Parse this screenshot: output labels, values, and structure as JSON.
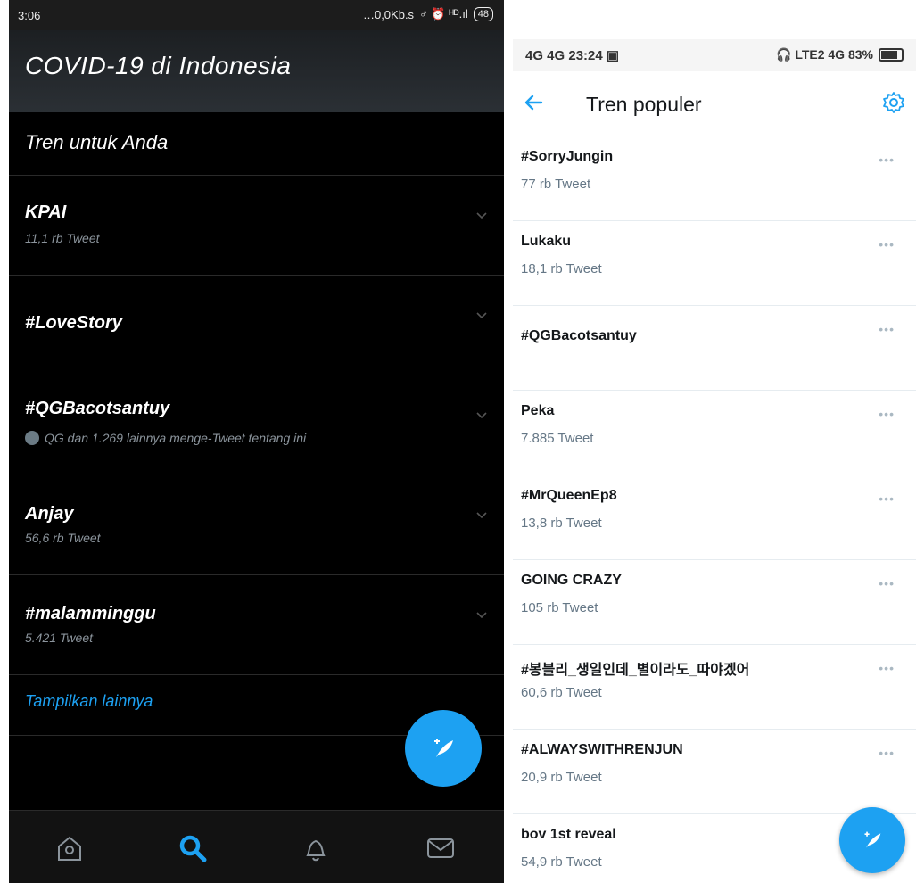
{
  "left": {
    "status_time": "3:06",
    "status_net": "…0,0Kb.s",
    "status_extra": "♂ ⏰ ᴴᴰ.ıl",
    "battery": "48",
    "header_title": "COVID-19 di Indonesia",
    "section_title": "Tren untuk Anda",
    "trends": [
      {
        "name": "KPAI",
        "sub": "11,1 rb Tweet"
      },
      {
        "name": "#LoveStory",
        "sub": ""
      },
      {
        "name": "#QGBacotsantuy",
        "sub": "QG dan 1.269 lainnya menge-Tweet tentang ini"
      },
      {
        "name": "Anjay",
        "sub": "56,6 rb Tweet"
      },
      {
        "name": "#malamminggu",
        "sub": "5.421 Tweet"
      }
    ],
    "show_more": "Tampilkan lainnya",
    "nav": [
      "home-icon",
      "search-icon",
      "bell-icon",
      "mail-icon"
    ],
    "accent": "#1da1f2"
  },
  "right": {
    "status_left": "4G 4G 23:24 ▣",
    "status_right": "🎧 LTE2 4G 83%",
    "header_title": "Tren populer",
    "trends": [
      {
        "name": "#SorryJungin",
        "sub": "77 rb Tweet"
      },
      {
        "name": "Lukaku",
        "sub": "18,1 rb Tweet"
      },
      {
        "name": "#QGBacotsantuy",
        "sub": ""
      },
      {
        "name": "Peka",
        "sub": "7.885 Tweet"
      },
      {
        "name": "#MrQueenEp8",
        "sub": "13,8 rb Tweet"
      },
      {
        "name": "GOING CRAZY",
        "sub": "105 rb Tweet"
      },
      {
        "name": "#봉블리_생일인데_별이라도_따야겠어",
        "sub": "60,6 rb Tweet"
      },
      {
        "name": "#ALWAYSWITHRENJUN",
        "sub": "20,9 rb Tweet"
      },
      {
        "name": "bov 1st reveal",
        "sub": "54,9 rb Tweet"
      }
    ],
    "more_dots": "•••",
    "accent": "#1da1f2"
  }
}
